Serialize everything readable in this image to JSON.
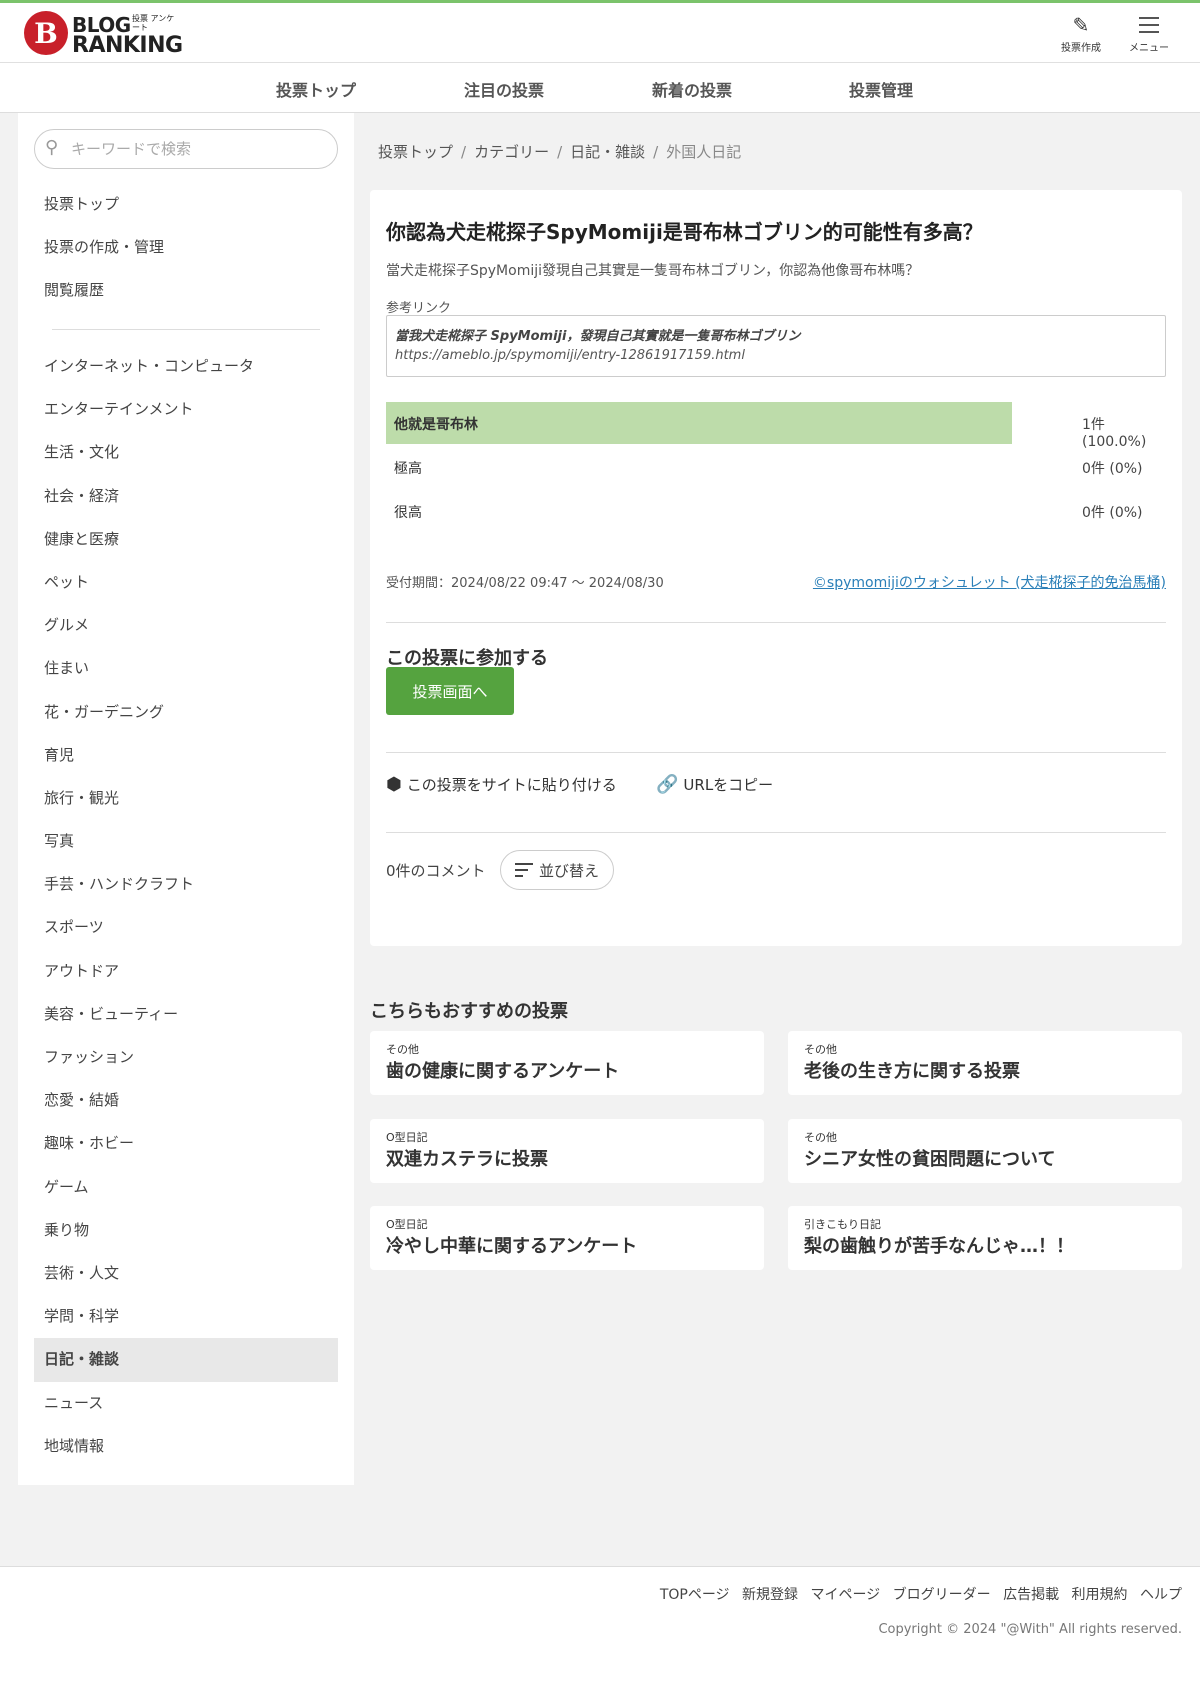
{
  "header": {
    "logo_blog": "BLOG",
    "logo_small": "投票 アンケート",
    "logo_ranking": "RANKING",
    "create_label": "投票作成",
    "menu_label": "メニュー"
  },
  "nav": [
    "投票トップ",
    "注目の投票",
    "新着の投票",
    "投票管理"
  ],
  "search": {
    "placeholder": "キーワードで検索"
  },
  "sidebar": {
    "top_items": [
      "投票トップ",
      "投票の作成・管理",
      "閲覧履歴"
    ],
    "categories": [
      "インターネット・コンピュータ",
      "エンターテインメント",
      "生活・文化",
      "社会・経済",
      "健康と医療",
      "ペット",
      "グルメ",
      "住まい",
      "花・ガーデニング",
      "育児",
      "旅行・観光",
      "写真",
      "手芸・ハンドクラフト",
      "スポーツ",
      "アウトドア",
      "美容・ビューティー",
      "ファッション",
      "恋愛・結婚",
      "趣味・ホビー",
      "ゲーム",
      "乗り物",
      "芸術・人文",
      "学問・科学",
      "日記・雑談",
      "ニュース",
      "地域情報"
    ],
    "active": "日記・雑談"
  },
  "breadcrumb": [
    "投票トップ",
    "カテゴリー",
    "日記・雑談",
    "外国人日記"
  ],
  "poll": {
    "title": "你認為犬走椛探子SpyMomiji是哥布林ゴブリン的可能性有多高？",
    "description": "當犬走椛探子SpyMomiji發現自己其實是一隻哥布林ゴブリン，你認為他像哥布林嗎？",
    "ref_label": "参考リンク",
    "ref_title": "當我犬走椛探子 SpyMomiji，發現自己其實就是一隻哥布林ゴブリン",
    "ref_url": "https://ameblo.jp/spymomiji/entry-12861917159.html",
    "options": [
      {
        "label": "他就是哥布林",
        "count": "1件 (100.0%)",
        "share": 1.0
      },
      {
        "label": "極高",
        "count": "0件 (0%)",
        "share": 0
      },
      {
        "label": "很高",
        "count": "0件 (0%)",
        "share": 0
      }
    ],
    "period": "受付期間：2024/08/22 09:47 〜 2024/08/30",
    "owner": "©spymomijiのウォシュレット (犬走椛探子的免治馬桶)",
    "join_heading": "この投票に参加する",
    "vote_button": "投票画面へ",
    "embed_label": "この投票をサイトに貼り付ける",
    "copy_url_label": "URLをコピー",
    "comments_count": "0件のコメント",
    "sort_label": "並び替え"
  },
  "recommend": {
    "heading": "こちらもおすすめの投票",
    "items": [
      {
        "category": "その他",
        "title": "歯の健康に関するアンケート"
      },
      {
        "category": "その他",
        "title": "老後の生き方に関する投票"
      },
      {
        "category": "O型日記",
        "title": "双連カステラに投票"
      },
      {
        "category": "その他",
        "title": "シニア女性の貧困問題について"
      },
      {
        "category": "O型日記",
        "title": "冷やし中華に関するアンケート"
      },
      {
        "category": "引きこもり日記",
        "title": "梨の歯触りが苦手なんじゃ…！！"
      }
    ]
  },
  "footer": {
    "links": [
      "TOPページ",
      "新規登録",
      "マイページ",
      "ブログリーダー",
      "広告掲載",
      "利用規約",
      "ヘルプ"
    ],
    "copyright": "Copyright © 2024 \"@With\" All rights reserved."
  },
  "colors": {
    "accent_bar": "#7bc36b",
    "winner_bar": "#bddcaa",
    "vote_button": "#55a33f",
    "link": "#2a7fb8",
    "logo_red": "#c8202a"
  }
}
